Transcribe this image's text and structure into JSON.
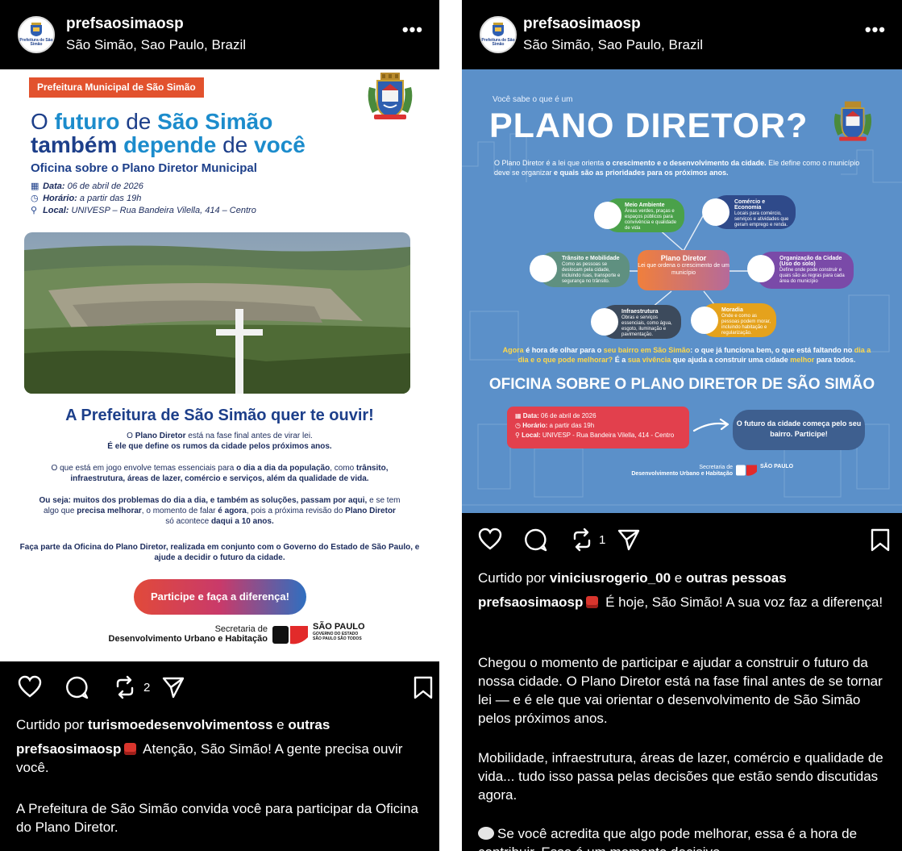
{
  "left": {
    "username": "prefsaosimaosp",
    "location": "São Simão, Sao Paulo, Brazil",
    "avatar_text": "Prefeitura de São Simão",
    "more": "•••",
    "flyer": {
      "tag": "Prefeitura Municipal de São Simão",
      "hl1a": "O",
      "hl1b": "futuro",
      "hl1c": "de",
      "hl1d": "São Simão",
      "hl2a": "também",
      "hl2b": "depende",
      "hl2c": "de",
      "hl2d": "você",
      "subtitle": "Oficina sobre o Plano Diretor Municipal",
      "data_label": "Data:",
      "data_value": " 06 de abril de 2026",
      "horario_label": "Horário:",
      "horario_value": " a partir das 19h",
      "local_label": "Local:",
      "local_value": " UNIVESP – Rua Bandeira Vilella, 414 – Centro",
      "headline2": "A Prefeitura de São Simão quer te ouvir!",
      "p1a": "O ",
      "p1b": "Plano Diretor",
      "p1c": " está na fase final antes de virar lei.",
      "p1d": "É ele que define os rumos da cidade pelos próximos anos.",
      "p2a": "O que está em jogo envolve temas essenciais para ",
      "p2b": "o dia a dia da população",
      "p2c": ", como ",
      "p2d": "trânsito,",
      "p2e": "infraestrutura, áreas de lazer, comércio e serviços, além da qualidade de vida.",
      "p3a": "Ou seja: muitos dos problemas do dia a dia, e também as soluções, passam por aqui,",
      "p3b": " e se tem",
      "p3c": "algo que ",
      "p3d": "precisa melhorar",
      "p3e": ", o momento de falar ",
      "p3f": "é agora",
      "p3g": ", pois a próxima revisão do ",
      "p3h": "Plano Diretor",
      "p3i": "só acontece ",
      "p3j": "daqui a 10 anos.",
      "p4": "Faça parte da Oficina do Plano Diretor, realizada em conjunto com o Governo do Estado de São Paulo, e ajude a decidir o futuro da cidade.",
      "cta": "Participe e faça a diferença!",
      "sec1": "Secretaria de",
      "sec2": "Desenvolvimento Urbano e Habitação",
      "sp": "SÃO PAULO",
      "sp_sub1": "GOVERNO DO ESTADO",
      "sp_sub2": "SÃO PAULO SÃO TODOS"
    },
    "repost_count": "2",
    "liked_prefix": "Curtido por ",
    "liked_user": "turismoedesenvolvimentoss",
    "liked_mid": " e ",
    "liked_others": "outras",
    "caption_user": "prefsaosimaosp",
    "caption_text": " Atenção, São Simão! A gente precisa ouvir você.",
    "caption_p2": "A Prefeitura de São Simão convida você para participar da Oficina do Plano Diretor."
  },
  "right": {
    "username": "prefsaosimaosp",
    "location": "São Simão, Sao Paulo, Brazil",
    "avatar_text": "Prefeitura de São Simão",
    "more": "•••",
    "flyer": {
      "q": "Você sabe o que é um",
      "title": "PLANO DIRETOR?",
      "intro_a": "O Plano Diretor é a lei que orienta ",
      "intro_b": "o crescimento e o desenvolvimento da cidade.",
      "intro_c": " Ele define como o município deve se organizar ",
      "intro_d": "e quais são as prioridades para os próximos anos.",
      "center_title": "Plano Diretor",
      "center_text": "Lei que ordena o crescimento de um município",
      "b_meio_t": "Meio Ambiente",
      "b_meio": "Áreas verdes, praças e espaços públicos para convivência e qualidade de vida",
      "b_com_t": "Comércio e Economia",
      "b_com": "Locais para comércio, serviços e atividades que geram emprego e renda.",
      "b_tra_t": "Trânsito e Mobilidade",
      "b_tra": "Como as pessoas se deslocam pela cidade, incluindo ruas, transporte e segurança no trânsito.",
      "b_org_t": "Organização da Cidade (Uso do solo)",
      "b_org": "Define onde pode construir e quais são as regras para cada área do município",
      "b_inf_t": "Infraestrutura",
      "b_inf": "Obras e serviços essenciais, como água, esgoto, iluminação e pavimentação.",
      "b_mor_t": "Moradia",
      "b_mor": "Onde e como as pessoas podem morar, incluindo habitação e regularização.",
      "agora_a": "Agora",
      "agora_b": " é hora de olhar para o ",
      "agora_c": "seu bairro em São Simão",
      "agora_d": ": o que já funciona bem, o que está faltando no",
      "agora_e": "dia a dia e o que pode melhorar?",
      "agora_f": " É a ",
      "agora_g": "sua vivência",
      "agora_h": " que ajuda a construir uma cidade ",
      "agora_i": "melhor",
      "agora_j": " para todos.",
      "oficina": "OFICINA SOBRE O PLANO DIRETOR DE SÃO SIMÃO",
      "data_label": "Data:",
      "data_value": " 06 de abril de 2026",
      "horario_label": "Horário:",
      "horario_value": " a partir das 19h",
      "local_label": "Local:",
      "local_value": " UNIVESP - Rua Bandeira Vilella, 414 - Centro",
      "blue": "O futuro da cidade começa pelo seu bairro. Participe!",
      "sec1": "Secretaria de",
      "sec2": "Desenvolvimento Urbano e Habitação",
      "sp": "SÃO PAULO"
    },
    "repost_count": "1",
    "liked_prefix": "Curtido por ",
    "liked_user": "viniciusrogerio_00",
    "liked_mid": " e ",
    "liked_others": "outras pessoas",
    "caption_user": "prefsaosimaosp",
    "caption_text": " É hoje, São Simão! A sua voz faz a diferença!",
    "caption_p2": "Chegou o momento de participar e ajudar a construir o futuro da nossa cidade. O Plano Diretor está na fase final antes de se tornar lei — e é ele que vai orientar o desenvolvimento de São Simão pelos próximos anos.",
    "caption_p3": "Mobilidade, infraestrutura, áreas de lazer, comércio e qualidade de vida... tudo isso passa pelas decisões que estão sendo discutidas agora.",
    "caption_p4": "Se você acredita que algo pode melhorar, essa é a hora de contribuir. Esse é um momento decisivo"
  }
}
